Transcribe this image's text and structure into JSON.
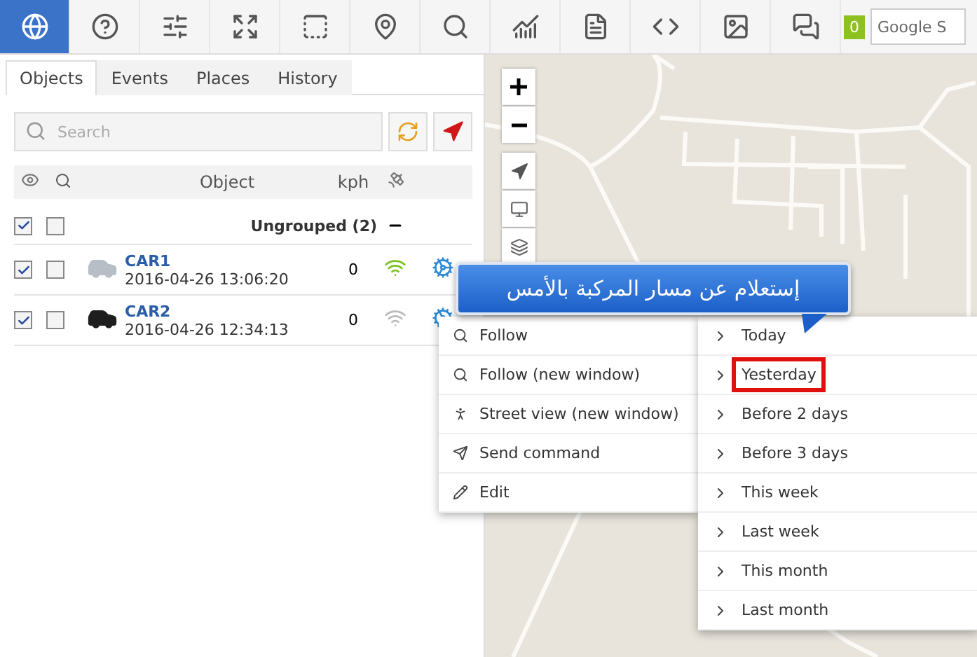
{
  "toolbar": {
    "buttons": [
      {
        "selected": true
      },
      {
        "selected": false
      },
      {
        "selected": false
      },
      {
        "selected": false
      },
      {
        "selected": false
      },
      {
        "selected": false
      },
      {
        "selected": false
      },
      {
        "selected": false
      },
      {
        "selected": false
      },
      {
        "selected": false
      },
      {
        "selected": false
      },
      {
        "selected": false
      }
    ],
    "badge": "0",
    "search": {
      "placeholder": "Google S"
    }
  },
  "tabs": [
    {
      "label": "Objects",
      "selected": true
    },
    {
      "label": "Events",
      "selected": false
    },
    {
      "label": "Places",
      "selected": false
    },
    {
      "label": "History",
      "selected": false
    }
  ],
  "search": {
    "placeholder": "Search"
  },
  "table": {
    "columns": [
      "Object",
      "kph"
    ],
    "group": {
      "name": "Ungrouped (2)",
      "visible": true,
      "followed": false
    },
    "rows": [
      {
        "name": "CAR1",
        "time": "2016-04-26 13:06:20",
        "speed": "0",
        "visible": true,
        "followed": false,
        "online": true,
        "color": "#b8bec6"
      },
      {
        "name": "CAR2",
        "time": "2016-04-26 12:34:13",
        "speed": "0",
        "visible": true,
        "followed": false,
        "online": false,
        "color": "#1e1e1e"
      }
    ]
  },
  "context_menu": {
    "items": [
      {
        "label": "Follow"
      },
      {
        "label": "Follow (new window)"
      },
      {
        "label": "Street view (new window)"
      },
      {
        "label": "Send command"
      },
      {
        "label": "Edit"
      }
    ]
  },
  "submenu": {
    "items": [
      {
        "label": "Today",
        "highlighted": false
      },
      {
        "label": "Yesterday",
        "highlighted": true
      },
      {
        "label": "Before 2 days",
        "highlighted": false
      },
      {
        "label": "Before 3 days",
        "highlighted": false
      },
      {
        "label": "This week",
        "highlighted": false
      },
      {
        "label": "Last week",
        "highlighted": false
      },
      {
        "label": "This month",
        "highlighted": false
      },
      {
        "label": "Last month",
        "highlighted": false
      }
    ]
  },
  "callout": {
    "text": "إستعلام عن مسار المركبة بالأمس"
  }
}
